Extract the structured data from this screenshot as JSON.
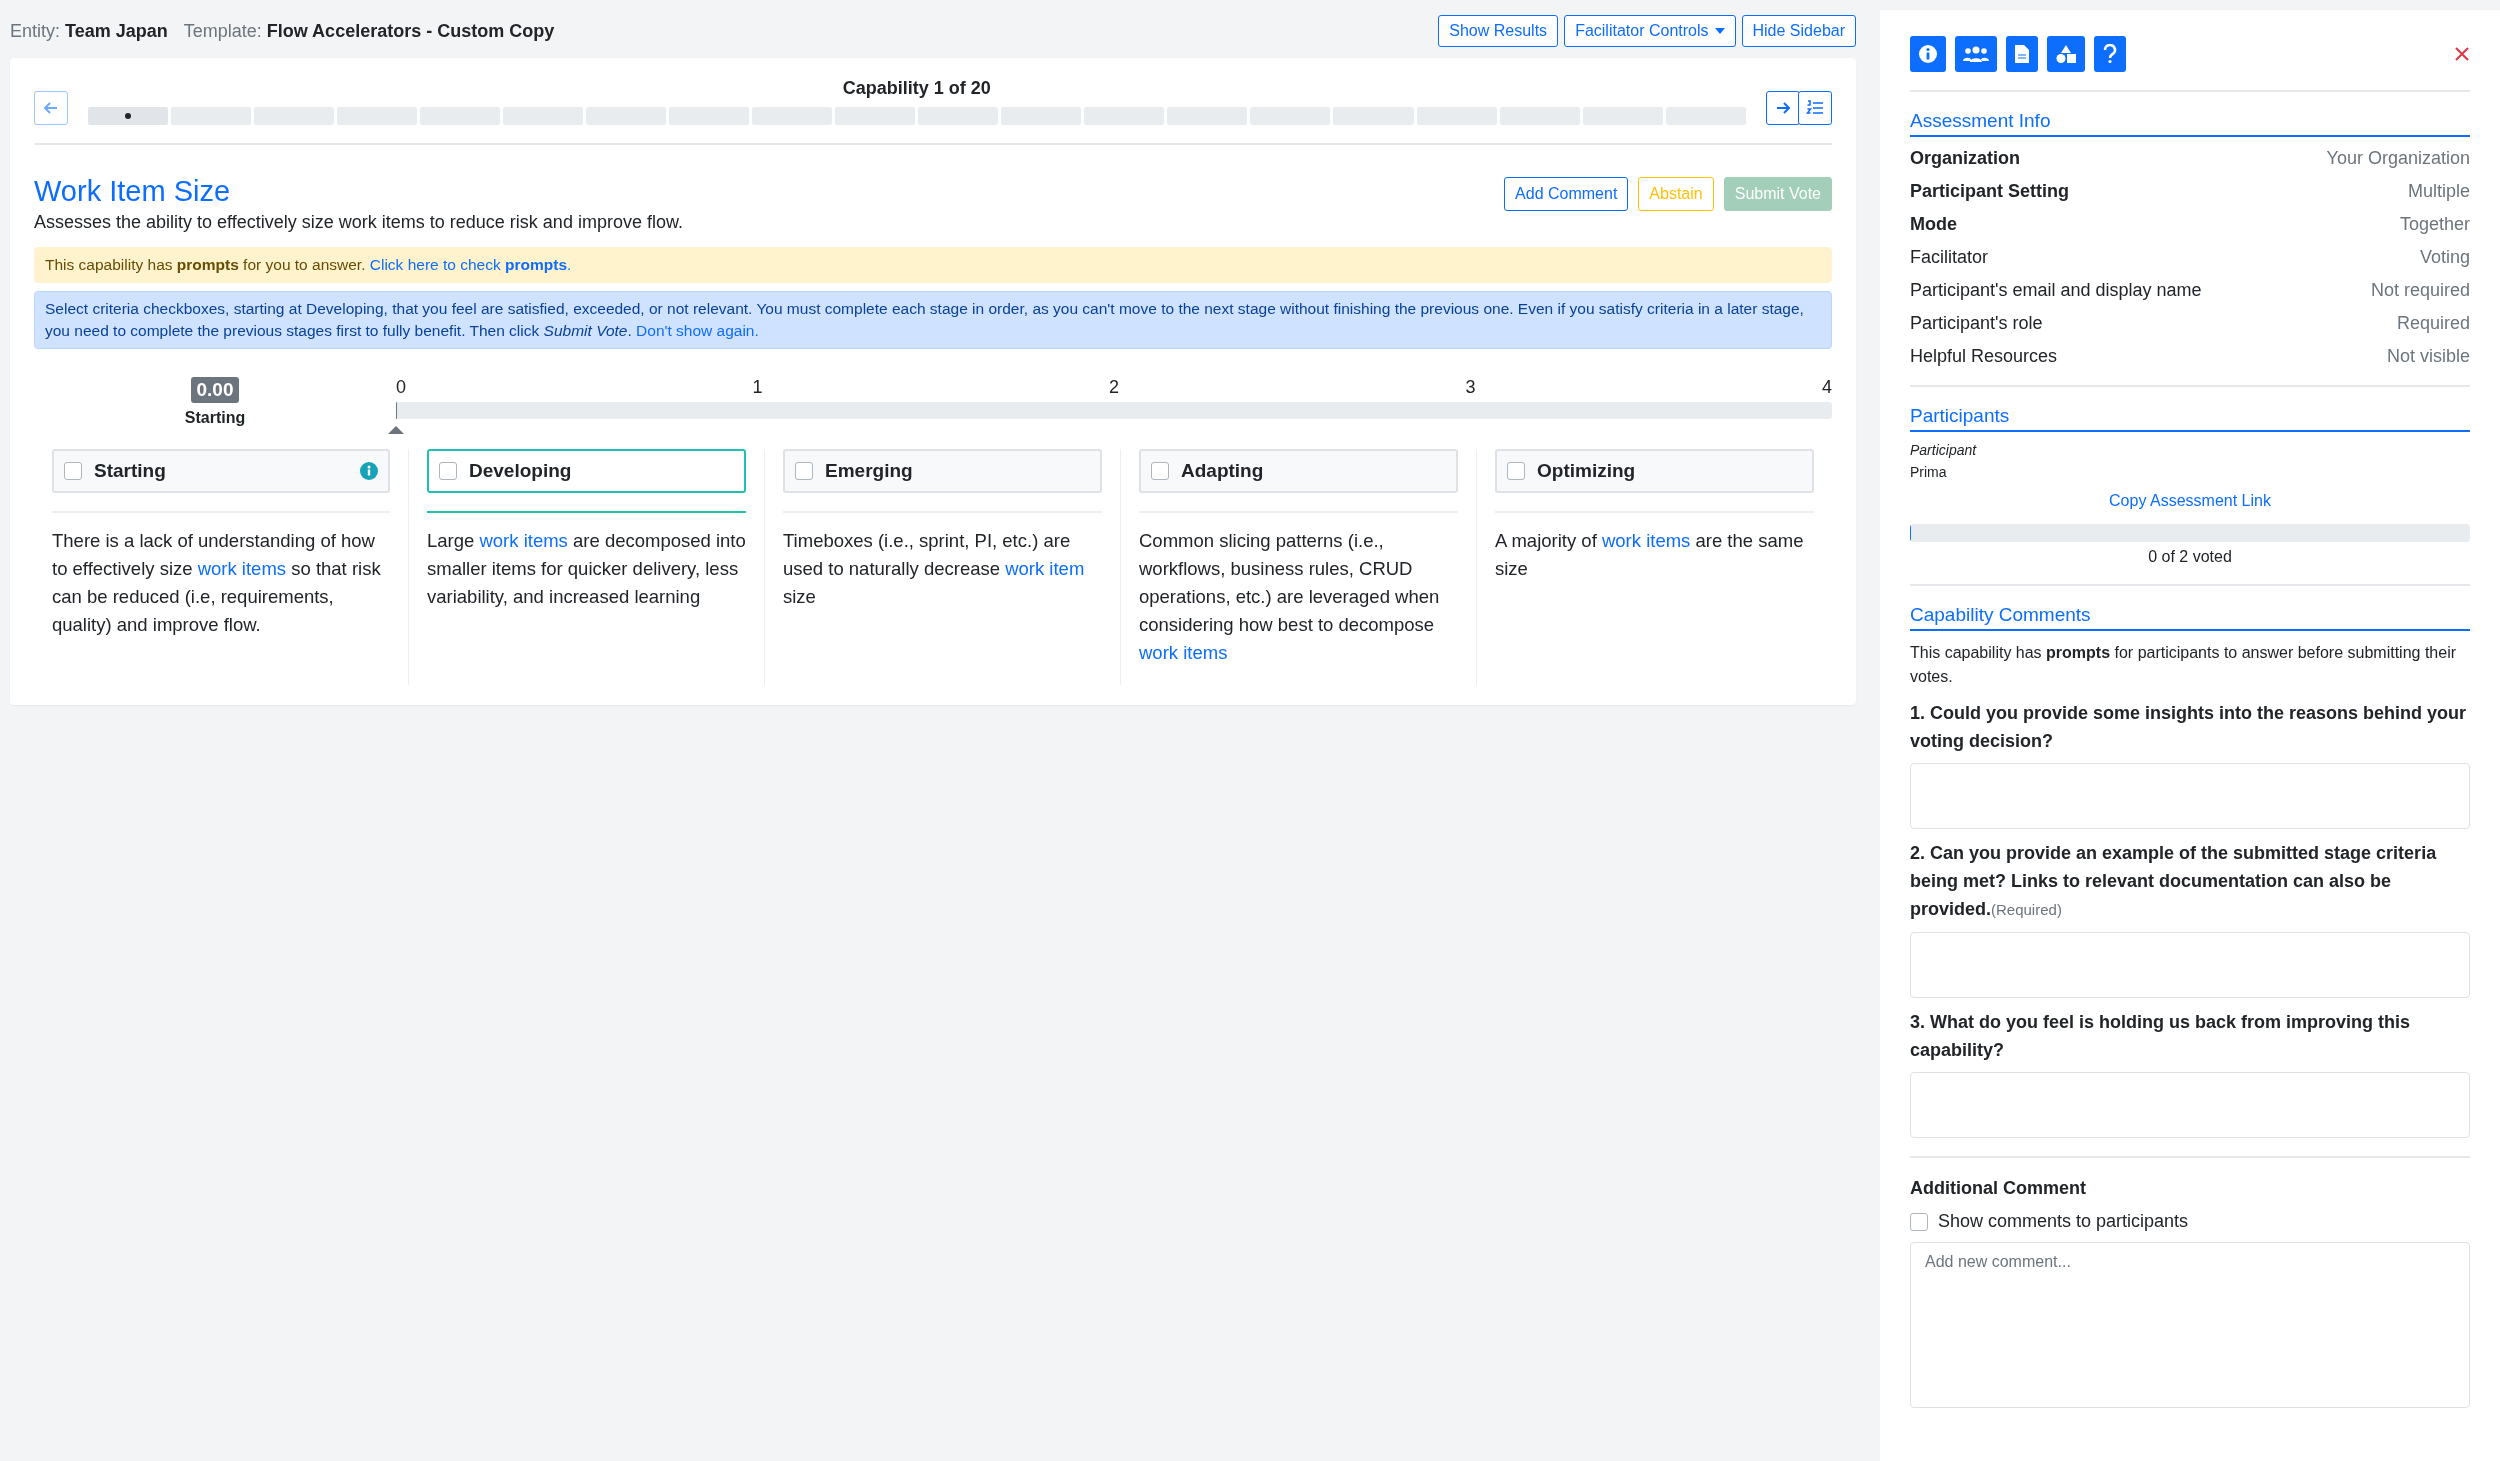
{
  "header": {
    "entity_label": "Entity:",
    "entity": "Team Japan",
    "template_label": "Template:",
    "template": "Flow Accelerators - Custom Copy",
    "buttons": [
      {
        "label": "Show Results",
        "dropdown": false
      },
      {
        "label": "Facilitator Controls",
        "dropdown": true
      },
      {
        "label": "Hide Sidebar",
        "dropdown": false
      }
    ]
  },
  "capability": {
    "counter": "Capability 1 of 20",
    "segments": [
      {
        "selected": true
      },
      {
        "selected": false
      },
      {
        "selected": false
      },
      {
        "selected": false
      },
      {
        "selected": false
      },
      {
        "selected": false
      },
      {
        "selected": false
      },
      {
        "selected": false
      },
      {
        "selected": false
      },
      {
        "selected": false
      },
      {
        "selected": false
      },
      {
        "selected": false
      },
      {
        "selected": false
      },
      {
        "selected": false
      },
      {
        "selected": false
      },
      {
        "selected": false
      },
      {
        "selected": false
      },
      {
        "selected": false
      },
      {
        "selected": false
      },
      {
        "selected": false
      }
    ],
    "title": "Work Item Size",
    "description": "Assesses the ability to effectively size work items to reduce risk and improve flow.",
    "actions": [
      {
        "label": "Add Comment",
        "kind": "primary",
        "disabled": false
      },
      {
        "label": "Abstain",
        "kind": "warning",
        "disabled": false
      },
      {
        "label": "Submit Vote",
        "kind": "success",
        "disabled": true
      }
    ],
    "prompt_alert": [
      {
        "kind": "text",
        "text": "This capability has **prompts** for you to answer. "
      },
      {
        "kind": "link",
        "text": "Click here to check **prompts**."
      }
    ],
    "info_alert": [
      {
        "kind": "text",
        "text": "Select criteria checkboxes, starting at Developing, that you feel are satisfied, exceeded, or not relevant. You must complete each stage in order, as you can't move to the next stage without finishing the previous one. Even if you satisfy criteria in a later stage, you need to complete the previous stages first to fully benefit. Then click *Submit Vote*. "
      },
      {
        "kind": "link",
        "text": "Don't show again."
      }
    ],
    "score": {
      "value": "0.00",
      "stage": "Starting"
    },
    "scale": {
      "ticks": [
        "0",
        "1",
        "2",
        "3",
        "4"
      ],
      "level": 0
    },
    "stages": [
      {
        "name": "Starting",
        "checked": false,
        "selected": false,
        "info": true,
        "parts": [
          {
            "kind": "text",
            "text": "There is a lack of understanding of how to effectively size "
          },
          {
            "kind": "link",
            "text": "work items"
          },
          {
            "kind": "text",
            "text": " so that risk can be reduced (i.e, requirements, quality) and improve flow."
          }
        ]
      },
      {
        "name": "Developing",
        "checked": false,
        "selected": true,
        "info": false,
        "parts": [
          {
            "kind": "text",
            "text": "Large "
          },
          {
            "kind": "link",
            "text": "work items"
          },
          {
            "kind": "text",
            "text": " are decomposed into smaller items for quicker delivery, less variability, and increased learning"
          }
        ]
      },
      {
        "name": "Emerging",
        "checked": false,
        "selected": false,
        "info": false,
        "parts": [
          {
            "kind": "text",
            "text": "Timeboxes (i.e., sprint, PI, etc.) are used to naturally decrease "
          },
          {
            "kind": "link",
            "text": "work item"
          },
          {
            "kind": "text",
            "text": " size"
          }
        ]
      },
      {
        "name": "Adapting",
        "checked": false,
        "selected": false,
        "info": false,
        "parts": [
          {
            "kind": "text",
            "text": "Common slicing patterns (i.e., workflows, business rules, CRUD operations, etc.) are leveraged when considering how best to decompose "
          },
          {
            "kind": "link",
            "text": "work items"
          }
        ]
      },
      {
        "name": "Optimizing",
        "checked": false,
        "selected": false,
        "info": false,
        "parts": [
          {
            "kind": "text",
            "text": "A majority of "
          },
          {
            "kind": "link",
            "text": "work items"
          },
          {
            "kind": "text",
            "text": " are the same size"
          }
        ]
      }
    ]
  },
  "sidebar": {
    "tabs": [
      {
        "kind": "info",
        "selected": true
      },
      {
        "kind": "people",
        "selected": true
      },
      {
        "kind": "document",
        "selected": true
      },
      {
        "kind": "shapes",
        "selected": true
      },
      {
        "kind": "help",
        "selected": true
      }
    ],
    "assessment_info": {
      "title": "Assessment Info",
      "rows": [
        {
          "label": "Organization",
          "value": "Your Organization",
          "emphasized": true
        },
        {
          "label": "Participant Setting",
          "value": "Multiple",
          "emphasized": true
        },
        {
          "label": "Mode",
          "value": "Together",
          "emphasized": true
        },
        {
          "label": "Facilitator",
          "value": "Voting",
          "emphasized": false
        },
        {
          "label": "Participant's email and display name",
          "value": "Not required",
          "emphasized": false
        },
        {
          "label": "Participant's role",
          "value": "Required",
          "emphasized": false
        },
        {
          "label": "Helpful Resources",
          "value": "Not visible",
          "emphasized": false
        }
      ]
    },
    "participants": {
      "title": "Participants",
      "items": [
        {
          "role": "Participant",
          "name": "Prima"
        }
      ],
      "copy_link": "Copy Assessment Link",
      "vote_progress": {
        "level": 0,
        "reading": "0 of 2 voted"
      }
    },
    "comments": {
      "title": "Capability Comments",
      "intro": "This capability has **prompts** for participants to answer before submitting their votes.",
      "questions": [
        {
          "text": "1. Could you provide some insights into the reasons behind your voting decision?"
        },
        {
          "text": "2. Can you provide an example of the submitted stage criteria being met? Links to relevant documentation can also be provided.",
          "note": "(Required)"
        },
        {
          "text": "3. What do you feel is holding us back from improving this capability?"
        }
      ],
      "additional": {
        "title": "Additional Comment",
        "show_to_participants": {
          "label": "Show comments to participants",
          "checked": false
        },
        "placeholder": "Add new comment..."
      }
    }
  }
}
